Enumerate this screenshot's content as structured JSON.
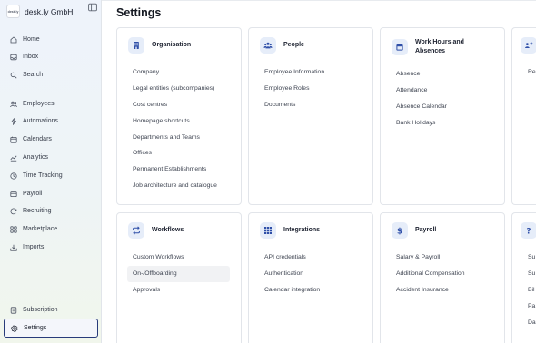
{
  "app": {
    "company": "desk.ly GmbH",
    "logo_text": "desk.ly"
  },
  "sidebar": {
    "items": [
      {
        "label": "Home"
      },
      {
        "label": "Inbox"
      },
      {
        "label": "Search"
      },
      {
        "label": "Employees"
      },
      {
        "label": "Automations"
      },
      {
        "label": "Calendars"
      },
      {
        "label": "Analytics"
      },
      {
        "label": "Time Tracking"
      },
      {
        "label": "Payroll"
      },
      {
        "label": "Recruiting"
      },
      {
        "label": "Marketplace"
      },
      {
        "label": "Imports"
      },
      {
        "label": "Subscription"
      },
      {
        "label": "Settings"
      }
    ],
    "active": "Settings"
  },
  "main": {
    "title": "Settings",
    "cards": [
      {
        "title": "Organisation",
        "icon": "building-icon",
        "links": [
          "Company",
          "Legal entities (subcompanies)",
          "Cost centres",
          "Homepage shortcuts",
          "Departments and Teams",
          "Offices",
          "Permanent Establishments",
          "Job architecture and catalogue"
        ]
      },
      {
        "title": "People",
        "icon": "people-icon",
        "links": [
          "Employee Information",
          "Employee Roles",
          "Documents"
        ]
      },
      {
        "title": "Work Hours and Absences",
        "icon": "calendar-icon",
        "links": [
          "Absence",
          "Attendance",
          "Absence Calendar",
          "Bank Holidays"
        ]
      },
      {
        "title": "",
        "icon": "recruiting-icon",
        "links": [
          "Re"
        ]
      },
      {
        "title": "Workflows",
        "icon": "workflow-icon",
        "links": [
          "Custom Workflows",
          "On-/Offboarding",
          "Approvals"
        ]
      },
      {
        "title": "Integrations",
        "icon": "grid-icon",
        "links": [
          "API credentials",
          "Authentication",
          "Calendar integration"
        ]
      },
      {
        "title": "Payroll",
        "icon": "dollar-icon",
        "links": [
          "Salary & Payroll",
          "Additional Compensation",
          "Accident Insurance"
        ]
      },
      {
        "title": "",
        "icon": "help-icon",
        "links": [
          "Su",
          "Su",
          "Bil",
          "Pa",
          "Da"
        ]
      }
    ],
    "highlighted_link": "On-/Offboarding"
  },
  "colors": {
    "accent": "#2f4fa8",
    "active_border": "#283b7a",
    "icon_bg": "#e6edf9"
  }
}
